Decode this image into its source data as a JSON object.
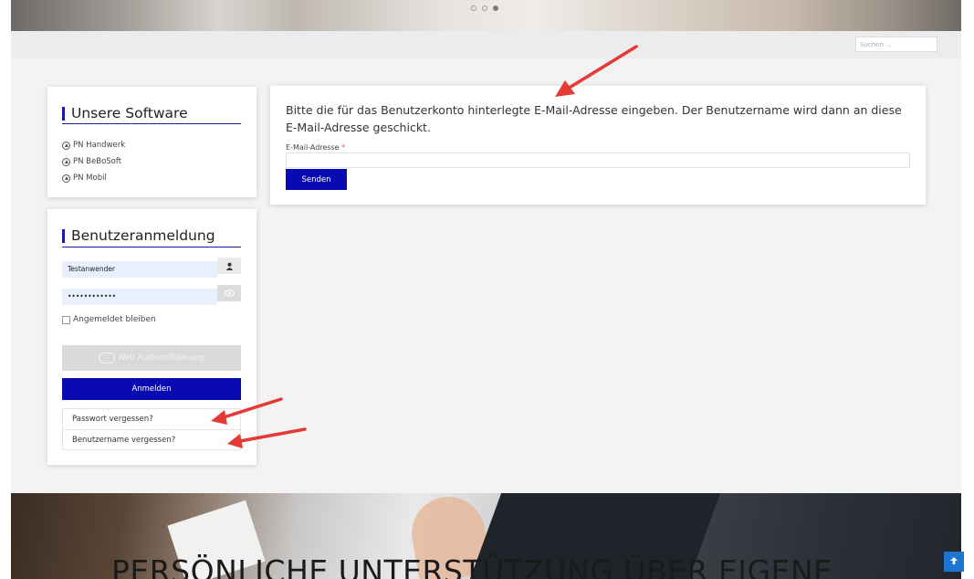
{
  "carousel": {
    "dots": 3,
    "active_index": 2
  },
  "search": {
    "placeholder": "Suchen ..."
  },
  "software": {
    "title": "Unsere Software",
    "items": [
      "PN Handwerk",
      "PN BeBoSoft",
      "PN Mobil"
    ]
  },
  "login": {
    "title": "Benutzeranmeldung",
    "username_value": "Testanwender",
    "password_value": "••••••••••••",
    "remember_label": "Angemeldet bleiben",
    "webauth_label": "Web Authentifizierung",
    "login_label": "Anmelden",
    "links": [
      "Passwort vergessen?",
      "Benutzername vergessen?"
    ]
  },
  "main": {
    "instruction": "Bitte die für das Benutzerkonto hinterlegte E-Mail-Adresse eingeben. Der Benutzername wird dann an diese E-Mail-Adresse geschickt.",
    "email_label": "E-Mail-Adresse",
    "required_mark": "*",
    "send_label": "Senden"
  },
  "hero": {
    "title": "PERSÖNLICHE UNTERSTÜTZUNG ÜBER EIGENE"
  },
  "colors": {
    "accent": "#0a0ab3",
    "annotation_arrow": "#e53935",
    "scroll_top": "#1b75d1"
  }
}
